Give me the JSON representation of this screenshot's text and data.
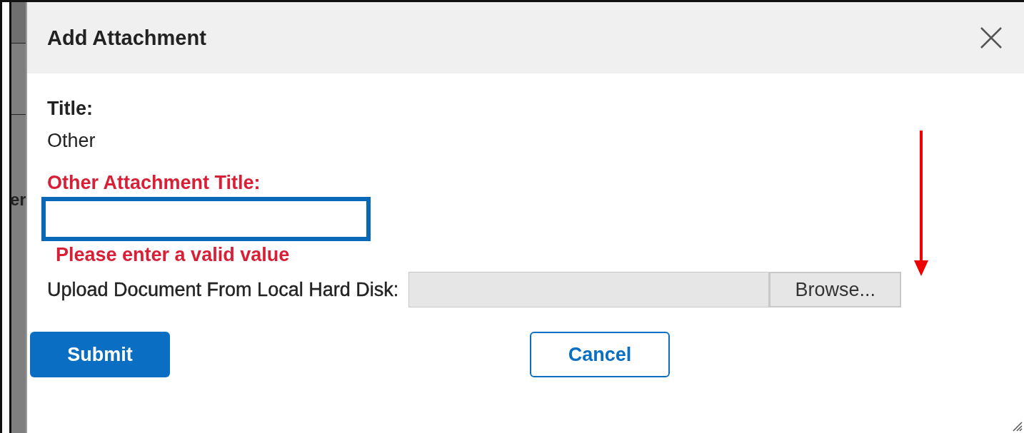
{
  "background": {
    "text": "er"
  },
  "dialog": {
    "title": "Add Attachment",
    "title_field": {
      "label": "Title:",
      "value": "Other"
    },
    "other_title": {
      "label": "Other Attachment Title:",
      "focused": true,
      "invalid": true,
      "error": "Please enter a valid value"
    },
    "upload": {
      "label": "Upload Document From Local Hard Disk:",
      "button": "Browse..."
    },
    "buttons": [
      {
        "label": "Submit",
        "kind": "primary"
      },
      {
        "label": "Cancel",
        "kind": "secondary"
      }
    ]
  }
}
